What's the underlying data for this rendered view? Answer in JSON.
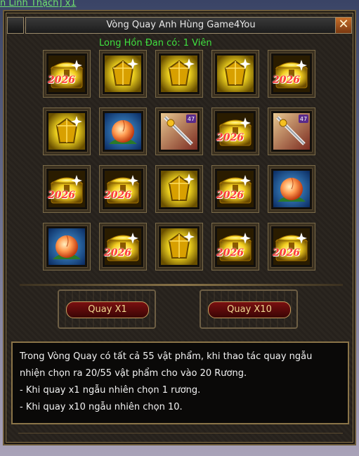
{
  "background_label": "n Linh Thạch] x1",
  "window": {
    "title": "Vòng Quay Anh Hùng Game4You",
    "close_glyph": "✕"
  },
  "currency": "Long Hồn Đan có: 1 Viên",
  "slot_year": "2026",
  "items": [
    [
      "chest",
      "gem",
      "gem",
      "gem",
      "chest"
    ],
    [
      "gem",
      "peach",
      "sword",
      "chest",
      "sword"
    ],
    [
      "chest",
      "chest",
      "gem",
      "chest",
      "peach"
    ],
    [
      "peach",
      "chest",
      "gem",
      "chest",
      "chest"
    ]
  ],
  "buttons": {
    "spin_x1": "Quay X1",
    "spin_x10": "Quay X10"
  },
  "info_lines": [
    "Trong Vòng Quay có tất cả 55 vật phẩm, khi thao tác quay ngẫu",
    "nhiện chọn ra 20/55 vật phẩm cho vào 20 Rương.",
    "- Khi quay x1 ngẫu nhiên chọn 1 rương.",
    "- Khi quay x10 ngẫu nhiên chọn 10."
  ],
  "colors": {
    "currency_green": "#3fe03f",
    "gold": "#f5d020",
    "year_red": "#ff3a3a"
  }
}
